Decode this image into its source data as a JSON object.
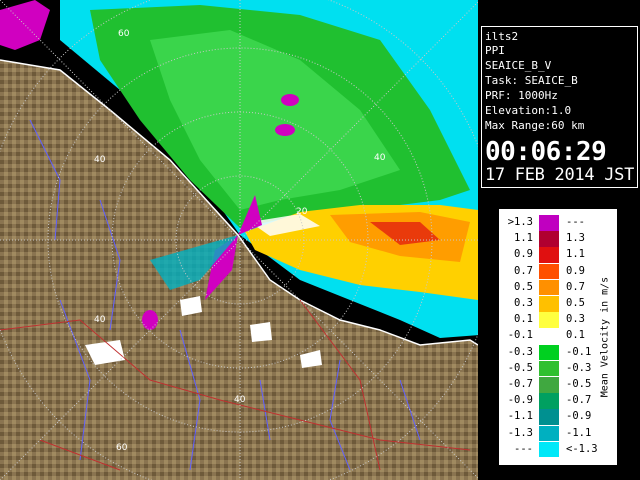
{
  "info": {
    "station": "ilts2",
    "scan_mode": "PPI",
    "product": "SEAICE_B_V",
    "task_label": "Task: SEAICE_B",
    "prf": "PRF: 1000Hz",
    "elevation": "Elevation:1.0",
    "max_range": "Max Range:60 km",
    "time": "00:06:29",
    "date": "17 FEB 2014 JST"
  },
  "legend": {
    "title": "Mean Velocity in m/s",
    "rows": [
      {
        "left": ">1.3",
        "right": "---",
        "color": "#c000c0"
      },
      {
        "left": "1.1",
        "right": "1.3",
        "color": "#b00030"
      },
      {
        "left": "0.9",
        "right": "1.1",
        "color": "#e01010"
      },
      {
        "left": "0.7",
        "right": "0.9",
        "color": "#ff5000"
      },
      {
        "left": "0.5",
        "right": "0.7",
        "color": "#ff9000"
      },
      {
        "left": "0.3",
        "right": "0.5",
        "color": "#ffc000"
      },
      {
        "left": "0.1",
        "right": "0.3",
        "color": "#ffff40"
      },
      {
        "left": "-0.1",
        "right": "0.1",
        "color": "#ffffff"
      },
      {
        "left": "-0.3",
        "right": "-0.1",
        "color": "#00d020"
      },
      {
        "left": "-0.5",
        "right": "-0.3",
        "color": "#30c030"
      },
      {
        "left": "-0.7",
        "right": "-0.5",
        "color": "#40a840"
      },
      {
        "left": "-0.9",
        "right": "-0.7",
        "color": "#00a060"
      },
      {
        "left": "-1.1",
        "right": "-0.9",
        "color": "#009090"
      },
      {
        "left": "-1.3",
        "right": "-1.1",
        "color": "#00b0c0"
      },
      {
        "left": "---",
        "right": "<-1.3",
        "color": "#00e8f8"
      }
    ]
  },
  "map": {
    "range_labels": [
      "20",
      "40",
      "60",
      "40",
      "40",
      "40",
      "60"
    ],
    "colors": {
      "land": "#8a7450",
      "sea_ice": "#00e0f0",
      "approaching": "#20c030",
      "receding": "#ffd000",
      "folded": "#d000c0",
      "rings": "#c8c8c8",
      "coast": "#ffffff",
      "rivers": "#6060ff",
      "roads": "#c03030"
    }
  }
}
